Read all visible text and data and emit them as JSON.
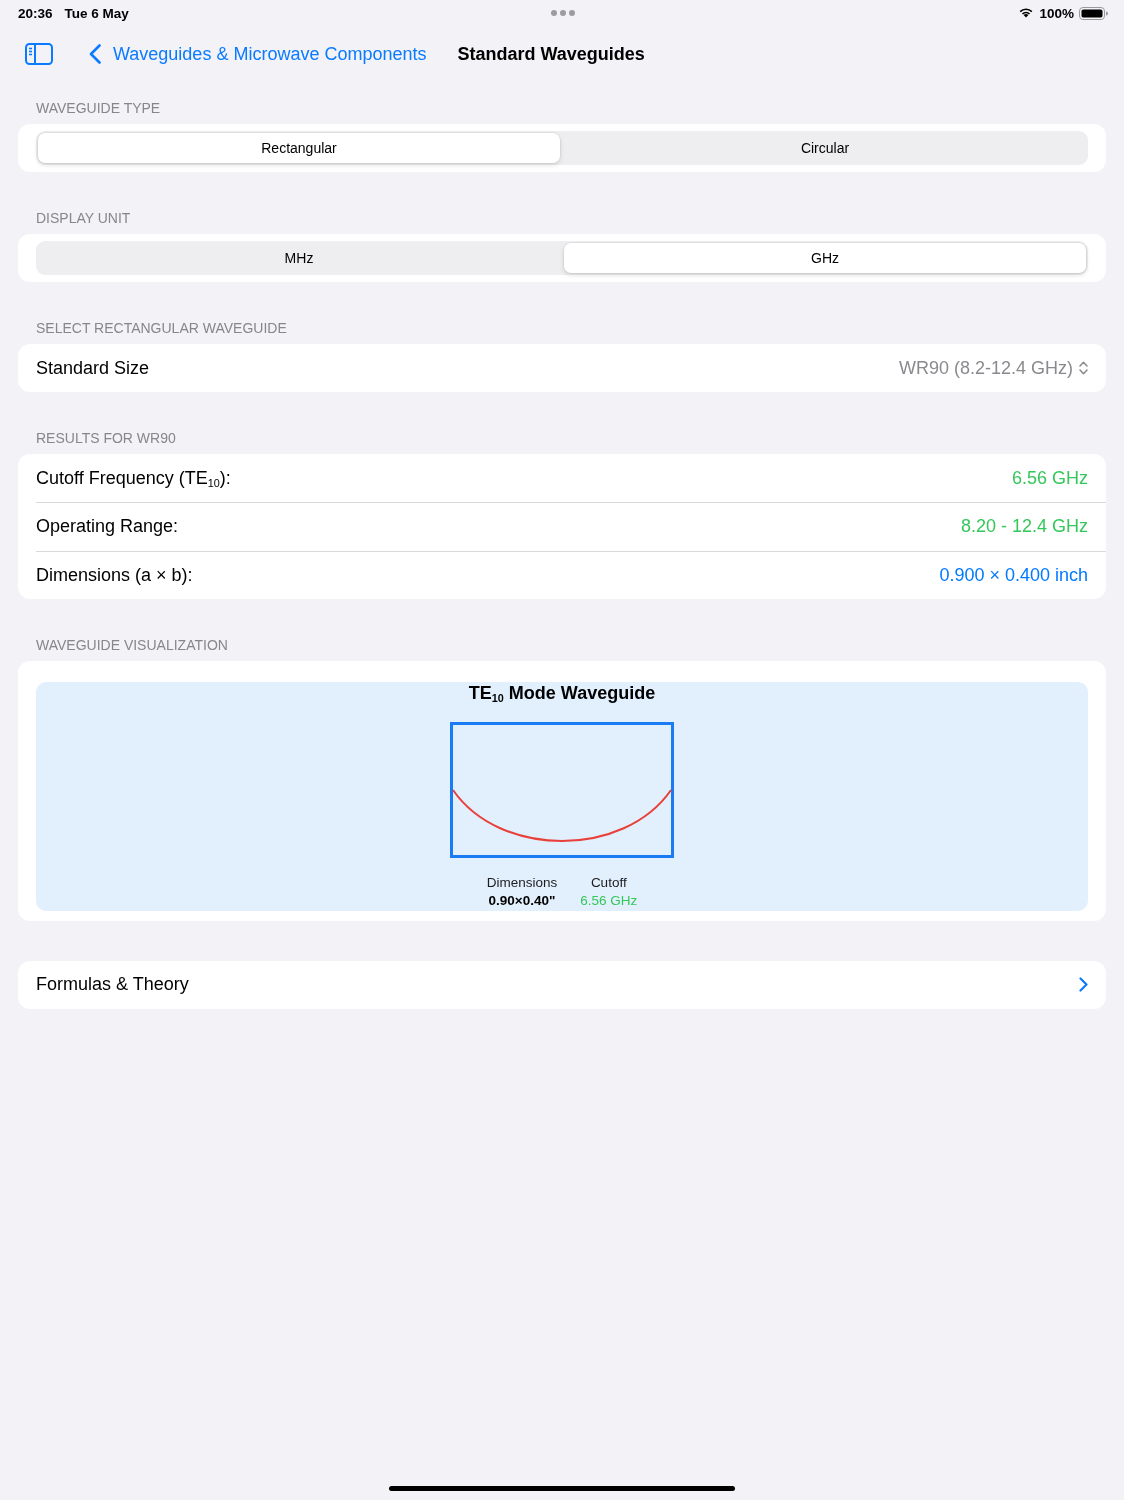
{
  "status_bar": {
    "time": "20:36",
    "date": "Tue 6 May",
    "battery": "100%"
  },
  "nav_bar": {
    "back_label": "Waveguides & Microwave Components",
    "title": "Standard Waveguides"
  },
  "waveguide_type": {
    "header": "WAVEGUIDE TYPE",
    "segments": [
      {
        "label": "Rectangular",
        "selected": true
      },
      {
        "label": "Circular",
        "selected": false
      }
    ]
  },
  "display_unit": {
    "header": "DISPLAY UNIT",
    "segments": [
      {
        "label": "MHz",
        "selected": false
      },
      {
        "label": "GHz",
        "selected": true
      }
    ]
  },
  "waveguide_select": {
    "header": "SELECT RECTANGULAR WAVEGUIDE",
    "label": "Standard Size",
    "value": "WR90 (8.2-12.4 GHz)"
  },
  "results": {
    "header": "RESULTS FOR WR90",
    "rows": [
      {
        "label": "Cutoff Frequency (TE$_{10}$):",
        "value": "6.56 GHz",
        "color": "#34c759"
      },
      {
        "label": "Operating Range:",
        "value": "8.20 - 12.4 GHz",
        "color": "#34c759"
      },
      {
        "label": "Dimensions (a × b):",
        "value": "0.900 × 0.400 inch",
        "color": "#007aff"
      }
    ]
  },
  "visualization": {
    "header": "WAVEGUIDE VISUALIZATION",
    "title": "TE$_{10}$ Mode Waveguide",
    "stats": [
      {
        "label": "Dimensions",
        "value": "0.90×0.40\"",
        "color": "#000000"
      },
      {
        "label": "Cutoff",
        "value": "6.56 GHz",
        "color": "#34c759"
      }
    ]
  },
  "formulas_link": {
    "label": "Formulas & Theory"
  }
}
